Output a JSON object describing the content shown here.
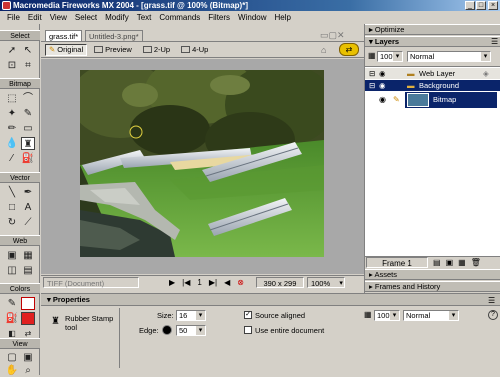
{
  "window": {
    "title": "Macromedia Fireworks MX 2004 - [grass.tif @ 100% (Bitmap)*]",
    "btn_min": "_",
    "btn_max": "□",
    "btn_close": "×"
  },
  "menu": [
    "File",
    "Edit",
    "View",
    "Select",
    "Modify",
    "Text",
    "Commands",
    "Filters",
    "Window",
    "Help"
  ],
  "tools": {
    "sections": [
      "Select",
      "Bitmap",
      "Vector",
      "Web",
      "Colors",
      "View"
    ]
  },
  "document": {
    "tabs": [
      "grass.tif*",
      "Untitled-3.png*"
    ],
    "view_modes": [
      "Original",
      "Preview",
      "2-Up",
      "4-Up"
    ],
    "status": {
      "file_type": "TIFF (Document)",
      "frame_number": "1",
      "dimensions": "390 x 299",
      "zoom": "100%"
    }
  },
  "panels": {
    "optimize": "Optimize",
    "layers": "Layers",
    "opacity": "100",
    "blend_mode": "Normal",
    "layer_list": [
      "Web Layer",
      "Background",
      "Bitmap"
    ],
    "frame_label": "Frame 1",
    "assets": "Assets",
    "frames_history": "Frames and History"
  },
  "properties": {
    "header": "Properties",
    "tool_name_line1": "Rubber Stamp",
    "tool_name_line2": "tool",
    "size_label": "Size:",
    "size_value": "16",
    "edge_label": "Edge:",
    "edge_value": "50",
    "source_aligned_label": "Source aligned",
    "source_aligned_checked": true,
    "use_entire_doc_label": "Use entire document",
    "use_entire_doc_checked": false,
    "opacity_value": "100",
    "blend_mode": "Normal",
    "help_icon": "?"
  },
  "colors": {
    "titlebar": "#0a246a",
    "selection": "#0a246a",
    "stroke": "#c00000",
    "fill": "#e02020"
  }
}
